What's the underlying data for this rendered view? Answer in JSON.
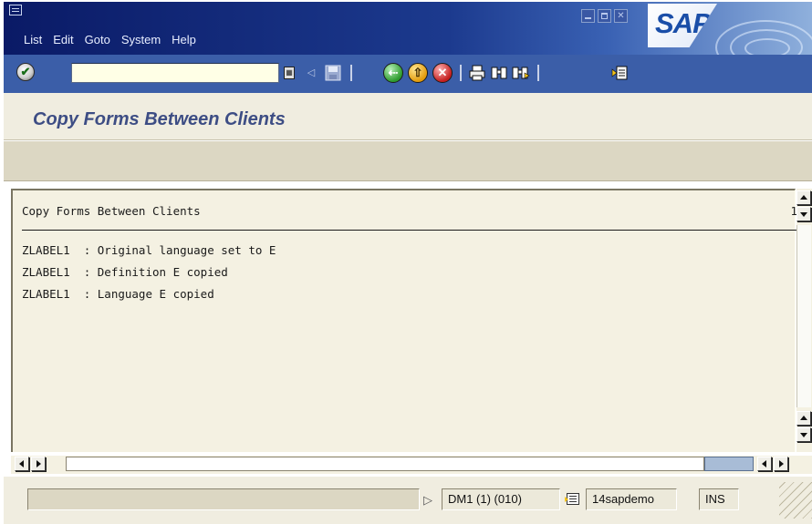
{
  "menubar": {
    "items": [
      "List",
      "Edit",
      "Goto",
      "System",
      "Help"
    ],
    "logo_text": "SAP"
  },
  "toolbar": {
    "command_field_value": "",
    "command_field_placeholder": "",
    "icons": [
      "enter-icon",
      "command-history-icon",
      "back-arrow-icon",
      "save-icon",
      "back-icon",
      "exit-icon",
      "cancel-icon",
      "print-icon",
      "find-icon",
      "find-next-icon",
      "create-session-icon"
    ]
  },
  "title_area": {
    "title": "Copy Forms Between Clients"
  },
  "list": {
    "header": "Copy Forms Between Clients",
    "page_number": "1",
    "lines": [
      "ZLABEL1  : Original language set to E",
      "ZLABEL1  : Definition E copied",
      "ZLABEL1  : Language E copied"
    ]
  },
  "status_bar": {
    "message": "",
    "system": "DM1 (1) (010)",
    "server": "14sapdemo",
    "mode": "INS"
  },
  "colors": {
    "menubar_dark": "#0a1a66",
    "toolbar_blue": "#3b5ea8",
    "title_text": "#3d4d84",
    "list_bg": "#f4f1e2",
    "chrome_bg": "#f0ede0"
  }
}
